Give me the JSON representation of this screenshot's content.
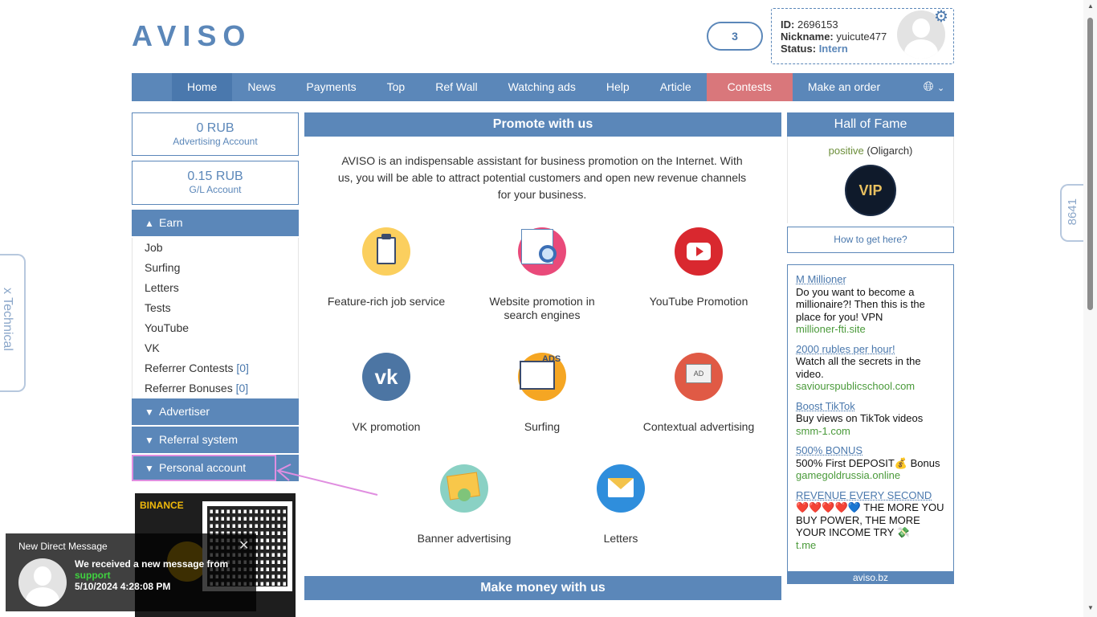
{
  "header": {
    "logo": "AVISO",
    "counter": "3",
    "user": {
      "id_label": "ID:",
      "id": "2696153",
      "nickname_label": "Nickname:",
      "nickname": "yuicute477",
      "status_label": "Status:",
      "status": "Intern"
    }
  },
  "nav": {
    "items": [
      "Home",
      "News",
      "Payments",
      "Top",
      "Ref Wall",
      "Watching ads",
      "Help",
      "Article",
      "Contests",
      "Make an order"
    ],
    "lang_icon": "globe-icon"
  },
  "left": {
    "advertising_account": {
      "amount": "0 RUB",
      "label": "Advertising Account"
    },
    "gl_account": {
      "amount": "0.15 RUB",
      "label": "G/L Account"
    },
    "earn": {
      "title": "Earn",
      "items": [
        "Job",
        "Surfing",
        "Letters",
        "Tests",
        "YouTube",
        "VK"
      ],
      "referrer_contests": "Referrer Contests",
      "referrer_contests_count": "[0]",
      "referrer_bonuses": "Referrer Bonuses",
      "referrer_bonuses_count": "[0]"
    },
    "advertiser": "Advertiser",
    "referral": "Referral system",
    "personal": "Personal account",
    "banner_brand": "BINANCE"
  },
  "center": {
    "promote_title": "Promote with us",
    "intro": "AVISO is an indispensable assistant for business promotion on the Internet. With us, you will be able to attract potential customers and open new revenue channels for your business.",
    "services": [
      "Feature-rich job service",
      "Website promotion in search engines",
      "YouTube Promotion",
      "VK promotion",
      "Surfing",
      "Contextual advertising",
      "Banner advertising",
      "Letters"
    ],
    "money_title": "Make money with us"
  },
  "right": {
    "hof_title": "Hall of Fame",
    "hof_name": "positive",
    "hof_rank": "(Oligarch)",
    "how_button": "How to get here?",
    "ads": [
      {
        "title": "M Millioner",
        "desc": "Do you want to become a millionaire?! Then this is the place for you! VPN",
        "url": "millioner-fti.site"
      },
      {
        "title": "2000 rubles per hour!",
        "desc": "Watch all the secrets in the video.",
        "url": "saviourspublicschool.com"
      },
      {
        "title": "Boost TikTok",
        "desc": "Buy views on TikTok videos",
        "url": "smm-1.com"
      },
      {
        "title": "500% BONUS",
        "desc": "500% First DEPOSIT💰 Bonus",
        "url": "gamegoldrussia.online"
      },
      {
        "title": "REVENUE EVERY SECOND",
        "desc": "❤️❤️❤️❤️💙 THE MORE YOU BUY POWER, THE MORE YOUR INCOME TRY 💸",
        "url": "t.me"
      }
    ],
    "footer": "aviso.bz"
  },
  "side": {
    "technical": "x Technical",
    "number": "8641"
  },
  "toast": {
    "title": "New Direct Message",
    "message": "We received a new message from",
    "from": "support",
    "time": "5/10/2024 4:28:08 PM"
  }
}
